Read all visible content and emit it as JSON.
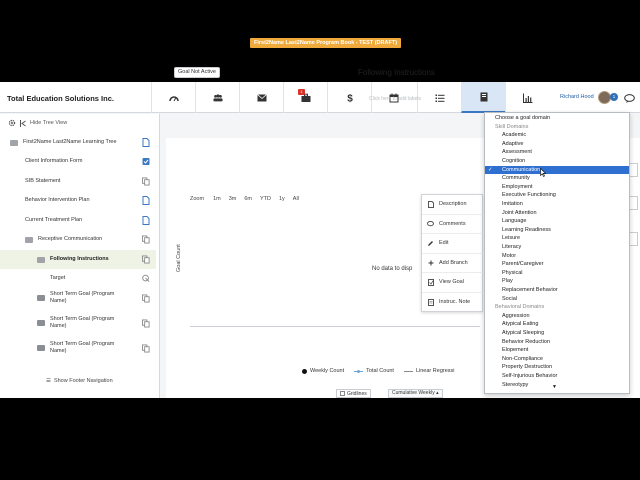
{
  "brand": "Total Education Solutions Inc.",
  "nav": {
    "icons": [
      "dashboard-icon",
      "users-icon",
      "mail-icon",
      "briefcase-icon",
      "dollar-icon",
      "calendar-icon",
      "list-icon",
      "book-icon",
      "chart-icon"
    ],
    "badge": "1",
    "user_name": "Richard Hood",
    "notification_count": "1"
  },
  "sidebar": {
    "hide_tree": "Hide Tree View",
    "items": [
      {
        "label": "First2Name Last2Name Learning Tree"
      },
      {
        "label": "Client Information Form"
      },
      {
        "label": "SIB Statement"
      },
      {
        "label": "Behavior Intervention Plan"
      },
      {
        "label": "Current Treatment Plan"
      },
      {
        "label": "Receptive Communication"
      },
      {
        "label": "Following Instructions"
      },
      {
        "label": "Target"
      },
      {
        "label": "Short Term Goal (Program Name)"
      },
      {
        "label": "Short Term Goal (Program Name)"
      },
      {
        "label": "Short Term Goal (Program Name)"
      }
    ],
    "footer": "Show Footer Navigation"
  },
  "main": {
    "program_book": "First2Name Last2Name Program Book - TEST (DRAFT)",
    "goal_status": "Goal Not Active",
    "goal_title": "Following Instructions",
    "click_labels": "Click here to add labels",
    "zoom_label": "Zoom",
    "zoom_options": [
      "1m",
      "3m",
      "6m",
      "YTD",
      "1y",
      "All"
    ],
    "no_data": "No data to disp",
    "legend": [
      "Weekly Count",
      "Total Count",
      "Linear Regressi"
    ],
    "gridlines": "Gridlines",
    "cumulative": "Cumulative Weekly"
  },
  "chart_data": {
    "type": "line",
    "title": "Following Instructions",
    "xlabel": "",
    "ylabel": "Goal Count",
    "series": [
      {
        "name": "Weekly Count",
        "values": []
      },
      {
        "name": "Total Count",
        "values": []
      },
      {
        "name": "Linear Regressi",
        "values": []
      }
    ],
    "grid": false
  },
  "context_menu": [
    "Description",
    "Comments",
    "Edit",
    "Add Branch",
    "View Goal",
    "Instruc. Note"
  ],
  "dropdown": {
    "placeholder": "Choose a goal domain",
    "groups": [
      {
        "label": "Skill Domains",
        "options": [
          "Academic",
          "Adaptive",
          "Assessment",
          "Cognition",
          "Communication",
          "Community",
          "Employment",
          "Executive Functioning",
          "Imitation",
          "Joint Attention",
          "Language",
          "Learning Readiness",
          "Leisure",
          "Literacy",
          "Motor",
          "Parent/Caregiver",
          "Physical",
          "Play",
          "Replacement Behavior",
          "Social"
        ]
      },
      {
        "label": "Behavioral Domains",
        "options": [
          "Aggression",
          "Atypical Eating",
          "Atypical Sleeping",
          "Behavior Reduction",
          "Elopement",
          "Non-Compliance",
          "Property Destruction",
          "Self-Injurious Behavior",
          "Stereotypy"
        ]
      }
    ],
    "selected": "Communication",
    "colors": {
      "selected_bg": "#2f6fcf"
    }
  }
}
